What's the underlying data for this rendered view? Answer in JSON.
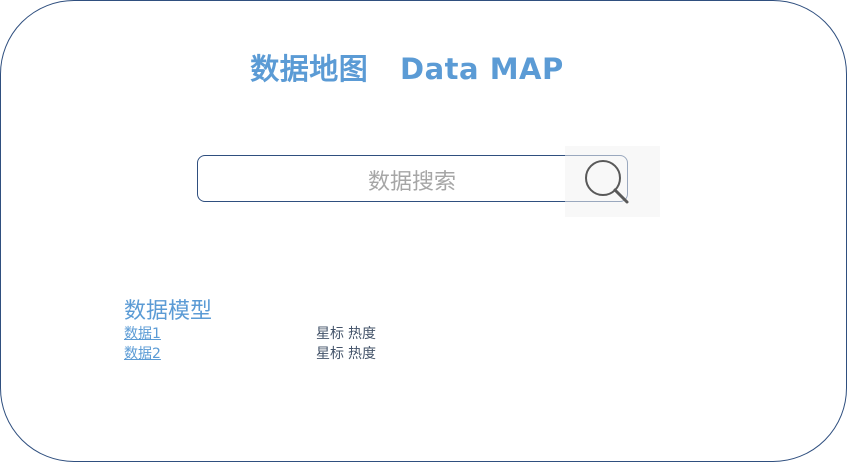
{
  "header": {
    "title": "数据地图   Data MAP"
  },
  "search": {
    "placeholder": "数据搜索",
    "button_icon": "search-icon"
  },
  "models": {
    "heading": "数据模型",
    "items": [
      {
        "name": "数据1",
        "star_label": "星标",
        "heat_label": "热度"
      },
      {
        "name": "数据2",
        "star_label": "星标",
        "heat_label": "热度"
      }
    ]
  },
  "colors": {
    "accent": "#5b9bd5",
    "border": "#2f4f7f",
    "placeholder": "#a6a6a6"
  }
}
